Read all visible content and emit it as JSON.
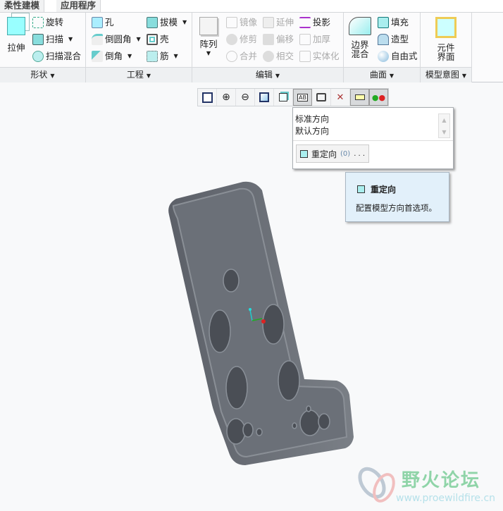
{
  "tabs": [
    "柔性建模",
    "应用程序"
  ],
  "groups": {
    "shape": {
      "label": "形状",
      "extrude": "拉伸",
      "revolve": "旋转",
      "sweep": "扫描",
      "swept_blend": "扫描混合"
    },
    "engineering": {
      "label": "工程",
      "hole": "孔",
      "round": "倒圆角",
      "chamfer": "倒角",
      "draft": "拔模",
      "shell": "壳",
      "rib": "筋"
    },
    "editing": {
      "label": "编辑",
      "pattern": "阵列",
      "mirror": "镜像",
      "trim": "修剪",
      "merge": "合并",
      "extend": "延伸",
      "offset": "偏移",
      "intersect": "相交",
      "project": "投影",
      "thicken": "加厚",
      "solidify": "实体化"
    },
    "surfaces": {
      "label": "曲面",
      "boundary_blend": [
        "边界",
        "混合"
      ],
      "fill": "填充",
      "style": "造型",
      "freestyle": "自由式"
    },
    "model_intent": {
      "label": "模型意图",
      "component_interface": [
        "元件",
        "界面"
      ]
    }
  },
  "view_toolbar": [
    "refit-icon",
    "zoom-in-icon",
    "zoom-out-icon",
    "repaint-icon",
    "display-style-icon",
    "saved-orientations-icon",
    "view-manager-icon",
    "datum-display-icon",
    "annotation-display-icon",
    "spin-center-icon"
  ],
  "dropdown": {
    "items": [
      "标准方向",
      "默认方向"
    ],
    "reorient_label": "重定向",
    "reorient_key": "(0)",
    "reorient_ellipsis": ". . ."
  },
  "tooltip": {
    "title": "重定向",
    "description": "配置模型方向首选项。"
  },
  "watermark": {
    "name": "野火论坛",
    "url": "www.proewildfire.cn"
  }
}
